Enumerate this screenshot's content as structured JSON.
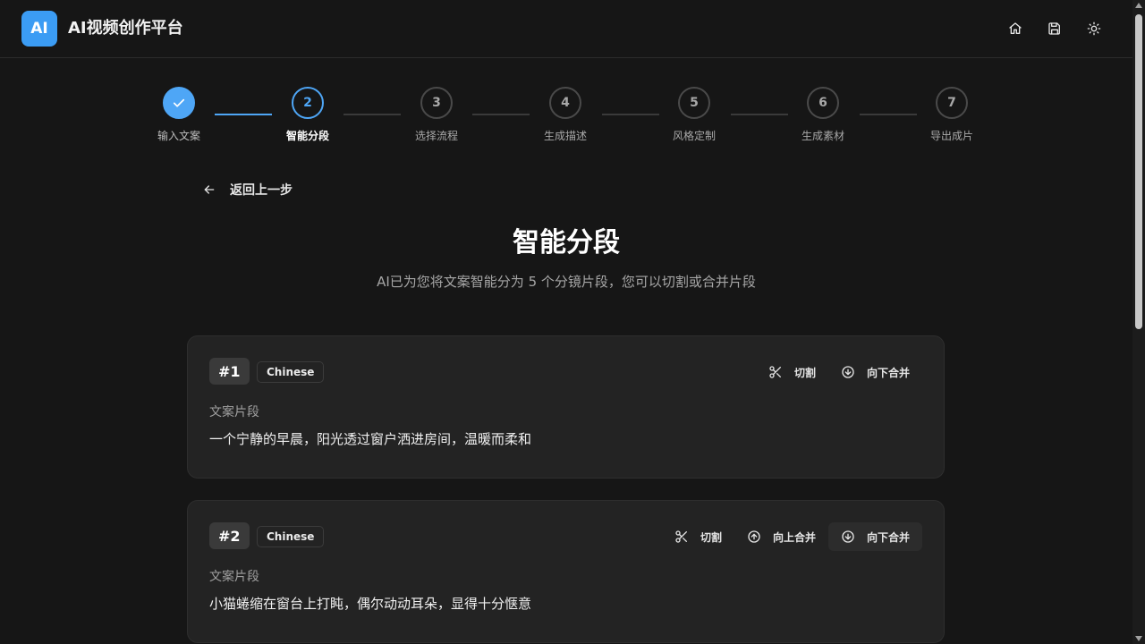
{
  "header": {
    "logo_text": "AI",
    "title": "AI视频创作平台",
    "icons": [
      "home-icon",
      "save-icon",
      "theme-toggle-icon"
    ]
  },
  "steps": [
    {
      "num": "1",
      "label": "输入文案",
      "state": "done"
    },
    {
      "num": "2",
      "label": "智能分段",
      "state": "active"
    },
    {
      "num": "3",
      "label": "选择流程",
      "state": "pending"
    },
    {
      "num": "4",
      "label": "生成描述",
      "state": "pending"
    },
    {
      "num": "5",
      "label": "风格定制",
      "state": "pending"
    },
    {
      "num": "6",
      "label": "生成素材",
      "state": "pending"
    },
    {
      "num": "7",
      "label": "导出成片",
      "state": "pending"
    }
  ],
  "back_label": "返回上一步",
  "page": {
    "title": "智能分段",
    "subtitle": "AI已为您将文案智能分为 5 个分镜片段，您可以切割或合并片段"
  },
  "segments": [
    {
      "num": "#1",
      "lang": "Chinese",
      "label": "文案片段",
      "text": "一个宁静的早晨，阳光透过窗户洒进房间，温暖而柔和",
      "actions": {
        "cut": "切割",
        "merge_down": "向下合并"
      }
    },
    {
      "num": "#2",
      "lang": "Chinese",
      "label": "文案片段",
      "text": "小猫蜷缩在窗台上打盹，偶尔动动耳朵，显得十分惬意",
      "actions": {
        "cut": "切割",
        "merge_up": "向上合并",
        "merge_down": "向下合并"
      }
    }
  ],
  "colors": {
    "accent": "#4ea6f6",
    "background": "#161616",
    "card": "#232323"
  }
}
